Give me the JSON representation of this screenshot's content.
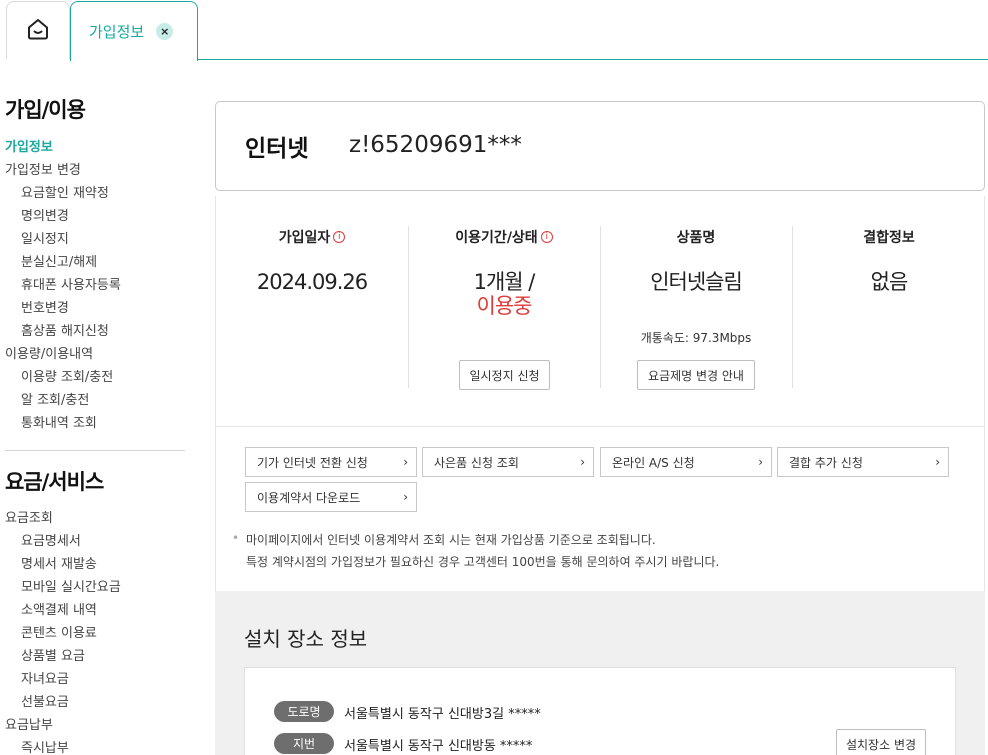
{
  "tabs": {
    "home_icon": "home-icon",
    "active_label": "가입정보",
    "close_icon": "close-icon",
    "close_glyph": "×"
  },
  "sidebar": {
    "group1_title": "가입/이용",
    "group1_items": [
      {
        "label": "가입정보",
        "level": 1,
        "active": true
      },
      {
        "label": "가입정보 변경",
        "level": 1
      },
      {
        "label": "요금할인 재약정",
        "level": 2
      },
      {
        "label": "명의변경",
        "level": 2
      },
      {
        "label": "일시정지",
        "level": 2
      },
      {
        "label": "분실신고/해제",
        "level": 2
      },
      {
        "label": "휴대폰 사용자등록",
        "level": 2
      },
      {
        "label": "번호변경",
        "level": 2
      },
      {
        "label": "홈상품 해지신청",
        "level": 2
      },
      {
        "label": "이용량/이용내역",
        "level": 1
      },
      {
        "label": "이용량 조회/충전",
        "level": 2
      },
      {
        "label": "알 조회/충전",
        "level": 2
      },
      {
        "label": "통화내역 조회",
        "level": 2
      }
    ],
    "group2_title": "요금/서비스",
    "group2_items": [
      {
        "label": "요금조회",
        "level": 1
      },
      {
        "label": "요금명세서",
        "level": 2
      },
      {
        "label": "명세서 재발송",
        "level": 2
      },
      {
        "label": "모바일 실시간요금",
        "level": 2
      },
      {
        "label": "소액결제 내역",
        "level": 2
      },
      {
        "label": "콘텐츠 이용료",
        "level": 2
      },
      {
        "label": "상품별 요금",
        "level": 2
      },
      {
        "label": "자녀요금",
        "level": 2
      },
      {
        "label": "선불요금",
        "level": 2
      },
      {
        "label": "요금납부",
        "level": 1
      },
      {
        "label": "즉시납부",
        "level": 2
      }
    ]
  },
  "service": {
    "name": "인터넷",
    "id": "z!65209691***"
  },
  "info": {
    "join_date_title": "가입일자",
    "join_date": "2024.09.26",
    "period_title": "이용기간/상태",
    "period": "1개월 /",
    "status": "이용중",
    "status_color": "#e03a3a",
    "pause_button": "일시정지 신청",
    "product_title": "상품명",
    "product": "인터넷슬림",
    "speed": "개통속도: 97.3Mbps",
    "plan_change_button": "요금제명 변경 안내",
    "bundle_title": "결합정보",
    "bundle": "없음",
    "info_glyph": "i"
  },
  "links": [
    "기가 인터넷 전환 신청",
    "사은품 신청 조회",
    "온라인 A/S 신청",
    "결합 추가 신청",
    "이용계약서 다운로드"
  ],
  "chevron_glyph": "›",
  "notice": {
    "line1": "마이페이지에서 인터넷 이용계약서 조회 시는 현재 가입상품 기준으로 조회됩니다.",
    "line2": "특정 계약시점의 가입정보가 필요하신 경우 고객센터 100번을 통해 문의하여 주시기 바랍니다."
  },
  "install": {
    "title": "설치 장소 정보",
    "road_badge": "도로명",
    "road_address": "서울특별시 동작구 신대방3길 *****",
    "lot_badge": "지번",
    "lot_address": "서울특별시 동작구 신대방동 *****",
    "change_button": "설치장소 변경"
  },
  "colors": {
    "accent": "#19a89b",
    "alert": "#e03a3a"
  }
}
